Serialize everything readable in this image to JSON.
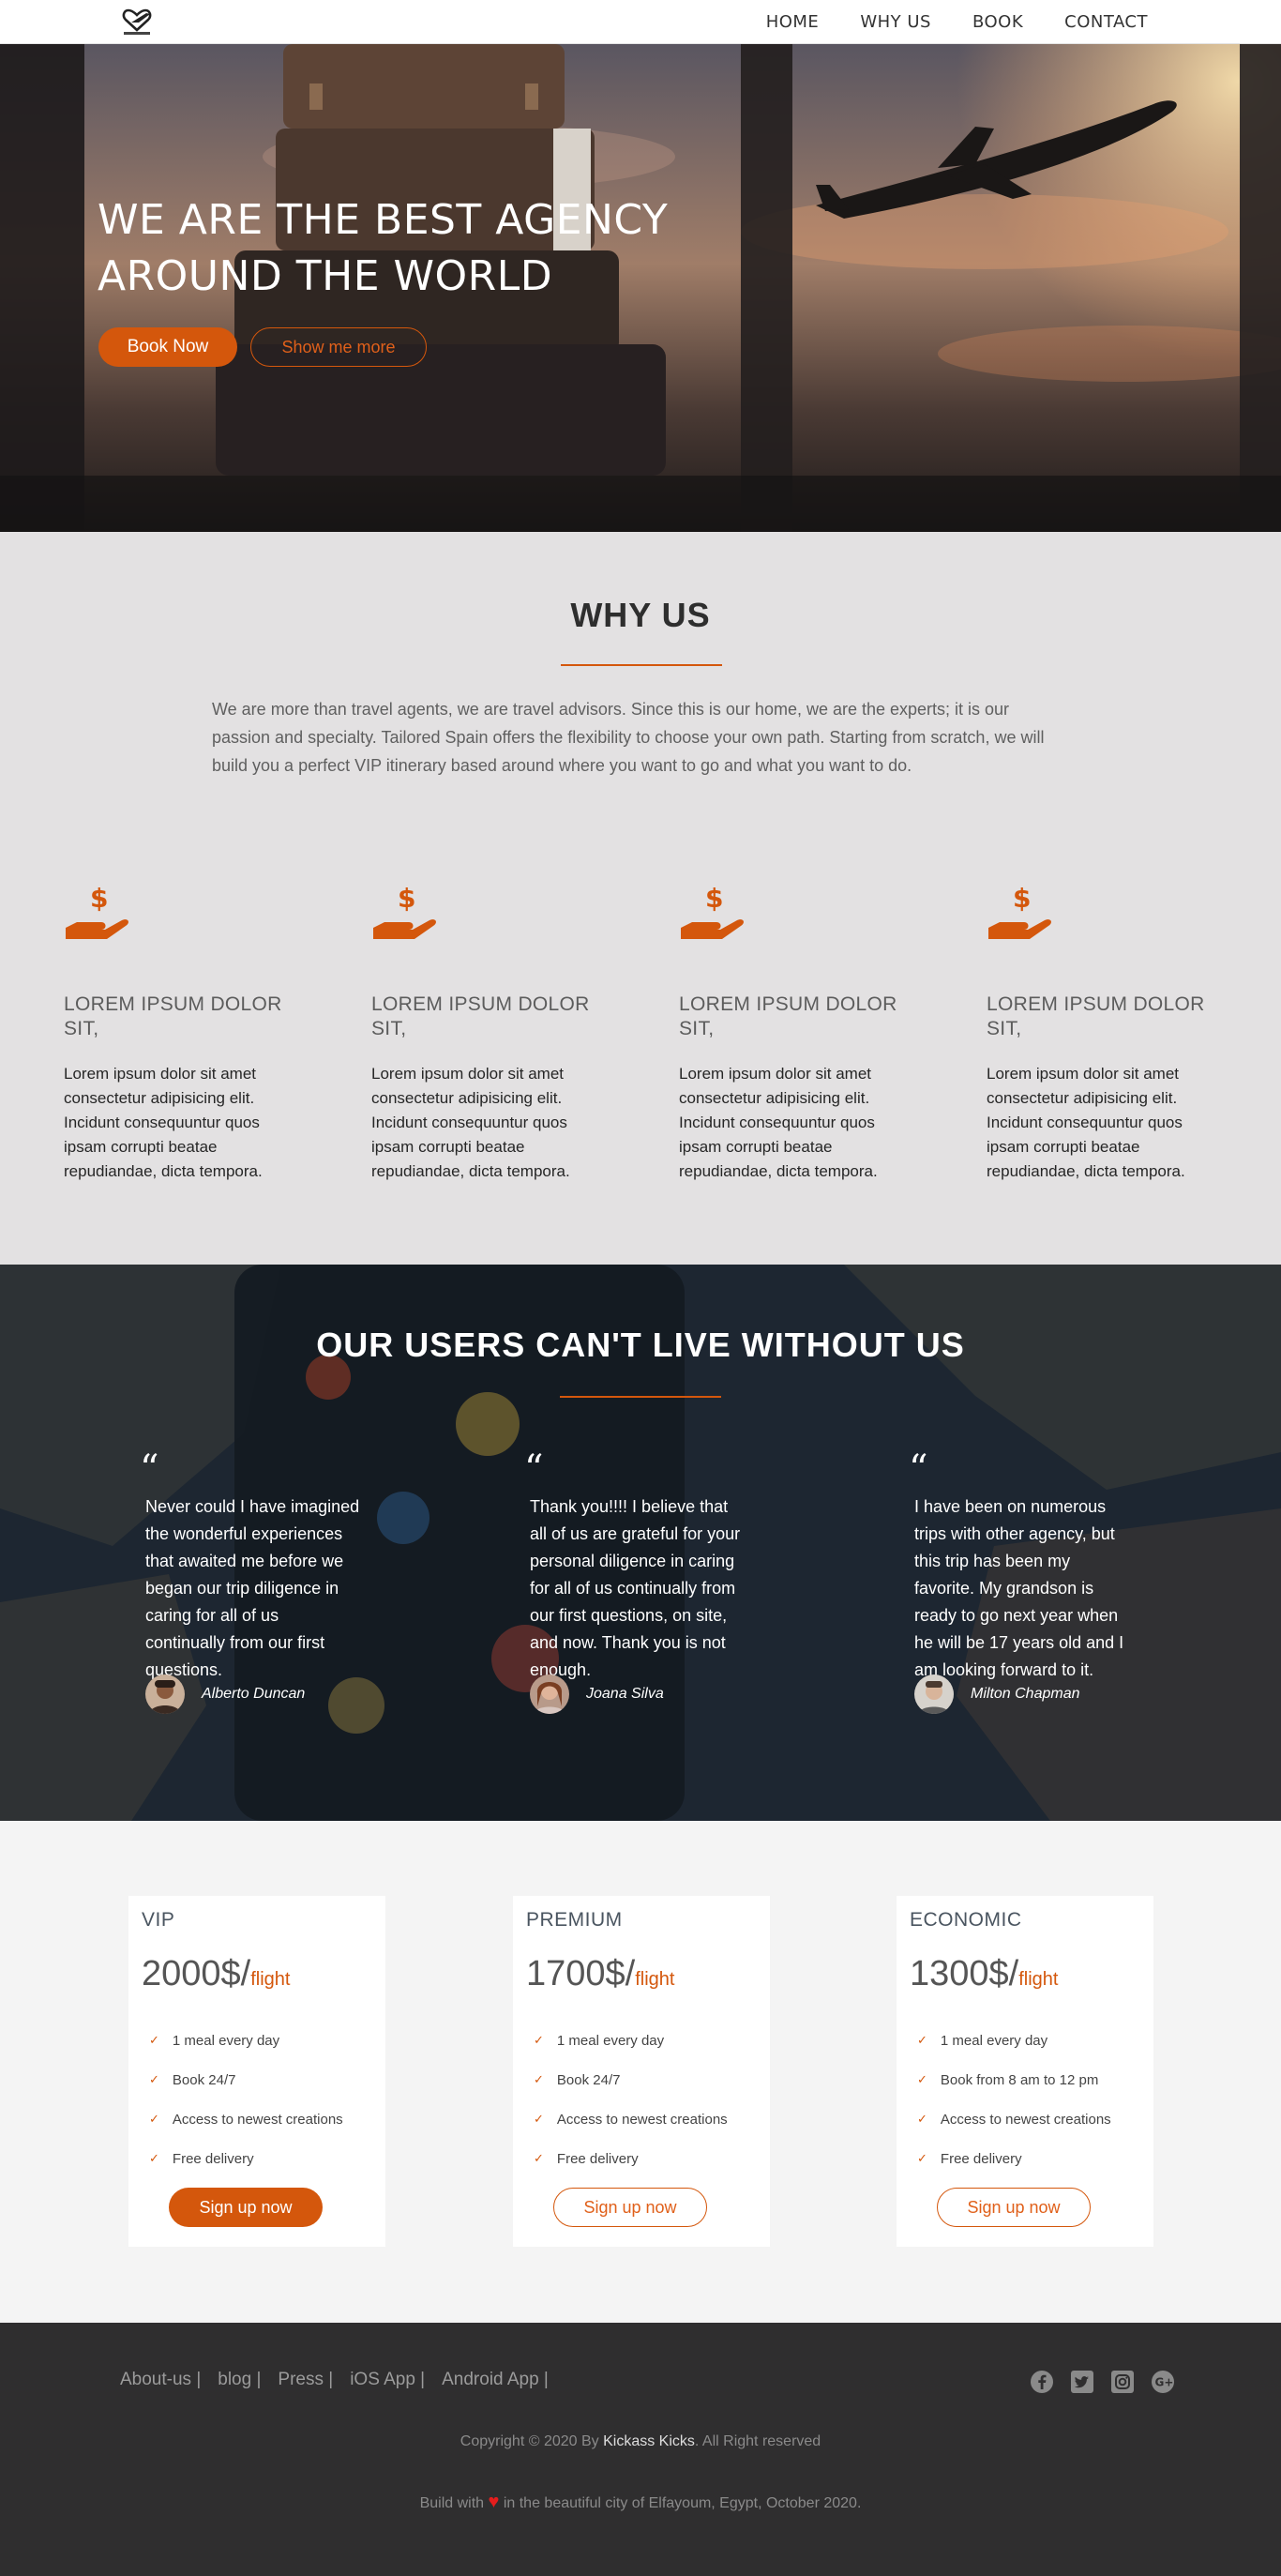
{
  "nav": {
    "logo_icon": "heart-plane-logo",
    "items": [
      {
        "label": "HOME"
      },
      {
        "label": "WHY US"
      },
      {
        "label": "BOOK"
      },
      {
        "label": "CONTACT"
      }
    ]
  },
  "hero": {
    "title_line1": "WE ARE THE BEST AGENCY",
    "title_line2": "AROUND THE WORLD",
    "primary_button": "Book Now",
    "secondary_button": "Show me more"
  },
  "why": {
    "title": "WHY US",
    "description": "We are more than travel agents, we are travel advisors. Since this is our home, we are the experts; it is our passion and specialty. Tailored Spain offers the flexibility to choose your own path. Starting from scratch, we will build you a perfect VIP itinerary based around where you want to go and what you want to do.",
    "features": [
      {
        "icon": "hand-dollar-icon",
        "title": "LOREM IPSUM DOLOR SIT,",
        "text": "Lorem ipsum dolor sit amet consectetur adipisicing elit. Incidunt consequuntur quos ipsam corrupti beatae repudiandae, dicta tempora."
      },
      {
        "icon": "hand-dollar-icon",
        "title": "LOREM IPSUM DOLOR SIT,",
        "text": "Lorem ipsum dolor sit amet consectetur adipisicing elit. Incidunt consequuntur quos ipsam corrupti beatae repudiandae, dicta tempora."
      },
      {
        "icon": "hand-dollar-icon",
        "title": "LOREM IPSUM DOLOR SIT,",
        "text": "Lorem ipsum dolor sit amet consectetur adipisicing elit. Incidunt consequuntur quos ipsam corrupti beatae repudiandae, dicta tempora."
      },
      {
        "icon": "hand-dollar-icon",
        "title": "LOREM IPSUM DOLOR SIT,",
        "text": "Lorem ipsum dolor sit amet consectetur adipisicing elit. Incidunt consequuntur quos ipsam corrupti beatae repudiandae, dicta tempora."
      }
    ]
  },
  "testimonials": {
    "title": "OUR USERS CAN'T LIVE WITHOUT US",
    "quote_mark": "“",
    "items": [
      {
        "text": "Never could I have imagined the wonderful experiences that awaited me before we began our trip diligence in caring for all of us continually from our first questions.",
        "author": "Alberto Duncan"
      },
      {
        "text": "Thank you!!!! I believe that all of us are grateful for your personal diligence in caring for all of us continually from our first questions, on site, and now. Thank you is not enough.",
        "author": "Joana Silva"
      },
      {
        "text": "I have been on numerous trips with other agency, but this trip has been my favorite. My grandson is ready to go next year when he will be 17 years old and I am looking forward to it.",
        "author": "Milton Chapman"
      }
    ]
  },
  "pricing": {
    "check_mark": "✓",
    "plans": [
      {
        "name": "VIP",
        "price": "2000$/",
        "unit": "flight",
        "features": [
          "1 meal every day",
          "Book 24/7",
          "Access to newest creations",
          "Free delivery"
        ],
        "button": "Sign up now"
      },
      {
        "name": "PREMIUM",
        "price": "1700$/",
        "unit": "flight",
        "features": [
          "1 meal every day",
          "Book 24/7",
          "Access to newest creations",
          "Free delivery"
        ],
        "button": "Sign up now"
      },
      {
        "name": "ECONOMIC",
        "price": "1300$/",
        "unit": "flight",
        "features": [
          "1 meal every day",
          "Book from 8 am to 12 pm",
          "Access to newest creations",
          "Free delivery"
        ],
        "button": "Sign up now"
      }
    ]
  },
  "footer": {
    "links": [
      "About-us |",
      "blog |",
      "Press |",
      "iOS App |",
      "Android App |"
    ],
    "social": [
      "facebook-icon",
      "twitter-icon",
      "instagram-icon",
      "google-plus-icon"
    ],
    "copyright_prefix": "Copyright © 2020 By ",
    "copyright_brand": "Kickass Kicks",
    "copyright_suffix": ". All Right reserved",
    "built_prefix": "Build with ",
    "built_suffix": " in the beautiful city of Elfayoum, Egypt, October 2020."
  },
  "colors": {
    "accent": "#d4570c",
    "footer_bg": "#2f2e2f",
    "section_bg": "#e3e1e2"
  }
}
